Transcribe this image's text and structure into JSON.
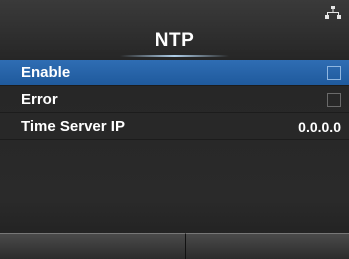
{
  "header": {
    "title": "NTP",
    "status_icon": "network-icon"
  },
  "settings": [
    {
      "label": "Enable",
      "control": "checkbox",
      "checked": false,
      "selected": true
    },
    {
      "label": "Error",
      "control": "checkbox",
      "checked": false,
      "selected": false
    },
    {
      "label": "Time Server IP",
      "control": "value",
      "value": "0.0.0.0",
      "selected": false
    }
  ],
  "footer": {
    "left_softkey_label": "",
    "right_softkey_label": ""
  },
  "colors": {
    "selected_row": "#2f6db3",
    "background": "#2b2b2b",
    "text": "#ffffff"
  }
}
